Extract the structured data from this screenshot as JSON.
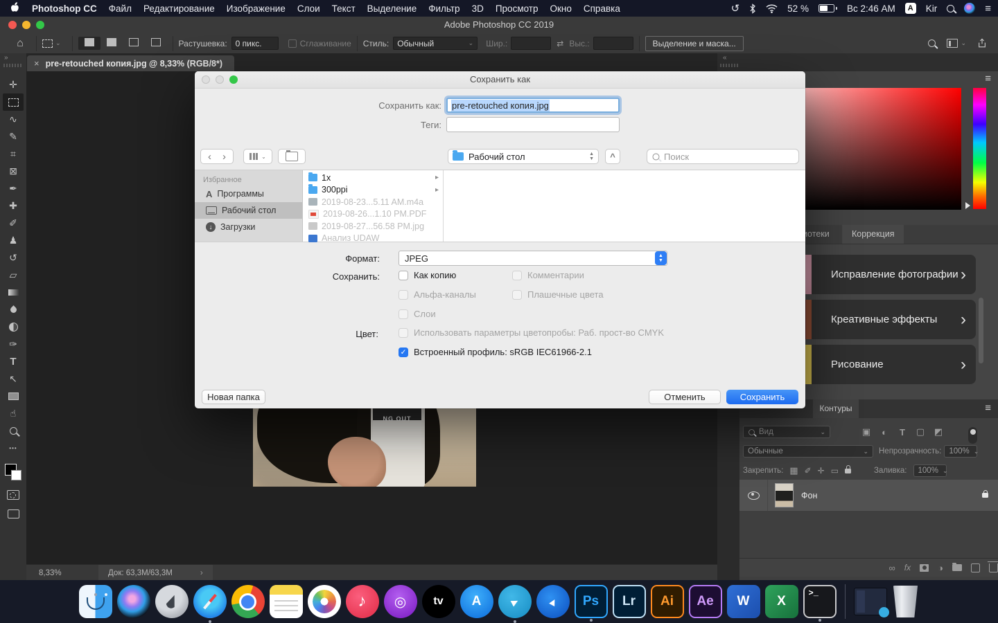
{
  "menubar": {
    "app_name": "Photoshop CC",
    "items": [
      "Файл",
      "Редактирование",
      "Изображение",
      "Слои",
      "Текст",
      "Выделение",
      "Фильтр",
      "3D",
      "Просмотр",
      "Окно",
      "Справка"
    ],
    "status": {
      "battery_pct": "52 %",
      "clock": "Вс 2:46 AM",
      "input_badge": "A",
      "layout": "Kir"
    }
  },
  "window": {
    "title": "Adobe Photoshop CC 2019"
  },
  "options": {
    "feather_label": "Растушевка:",
    "feather_value": "0 пикс.",
    "smoothing_label": "Сглаживание",
    "style_label": "Стиль:",
    "style_value": "Обычный",
    "width_label": "Шир.:",
    "height_label": "Выс.:",
    "select_mask_btn": "Выделение и маска..."
  },
  "doc_tab": {
    "title": "pre-retouched копия.jpg @ 8,33% (RGB/8*)"
  },
  "dialog": {
    "title": "Сохранить как",
    "saveas_label": "Сохранить как:",
    "filename": "pre-retouched копия.jpg",
    "tags_label": "Теги:",
    "location": "Рабочий стол",
    "search_placeholder": "Поиск",
    "favorites_header": "Избранное",
    "sidebar": [
      {
        "label": "Программы"
      },
      {
        "label": "Рабочий стол"
      },
      {
        "label": "Загрузки"
      }
    ],
    "files": [
      {
        "name": "1x"
      },
      {
        "name": "300ppi"
      },
      {
        "name": "2019-08-23...5.11 AM.m4a"
      },
      {
        "name": "2019-08-26...1.10 PM.PDF"
      },
      {
        "name": "2019-08-27...56.58 PM.jpg"
      },
      {
        "name": "Анализ UDAW"
      }
    ],
    "format_label": "Формат:",
    "format_value": "JPEG",
    "save_label": "Сохранить:",
    "opt_copy": "Как копию",
    "opt_comments": "Комментарии",
    "opt_alpha": "Альфа-каналы",
    "opt_spot": "Плашечные цвета",
    "opt_layers": "Слои",
    "color_label": "Цвет:",
    "proof_option": "Использовать параметры цветопробы:  Раб. прост-во CMYK",
    "profile_option": "Встроенный профиль:  sRGB IEC61966-2.1",
    "new_folder_btn": "Новая папка",
    "cancel_btn": "Отменить",
    "save_btn": "Сохранить"
  },
  "panels": {
    "libraries_tab": "Библиотеки",
    "adjust_tab": "Коррекция",
    "cards": [
      {
        "label": "Исправление фотографии"
      },
      {
        "label": "Креативные эффекты"
      },
      {
        "label": "Рисование"
      }
    ],
    "paths_tab": "Контуры",
    "layers": {
      "view_filter": "Вид",
      "blend_mode": "Обычные",
      "opacity_label": "Непрозрачность:",
      "opacity_value": "100%",
      "pin_label": "Закрепить:",
      "fill_label": "Заливка:",
      "fill_value": "100%",
      "layer_name": "Фон",
      "fx_label": "fx"
    }
  },
  "status_bar": {
    "zoom": "8,33%",
    "doc_info": "Док: 63,3M/63,3M"
  },
  "canvas": {
    "print_text": "NG OUT"
  },
  "dock": {
    "ps": "Ps",
    "lr": "Lr",
    "ai": "Ai",
    "ae": "Ae",
    "word": "W",
    "excel": "X",
    "tv_label": "tv",
    "appstore_label": "A",
    "terminal_prompt": ">_",
    "music_note": "♪",
    "podcast_glyph": "◎"
  },
  "icons": {
    "menu": "≡",
    "time_machine": "↺",
    "back": "‹",
    "forward": "›",
    "chev_down": "⌄",
    "chev_up": "^",
    "row_arrow": "▸",
    "breadcrumb": "›",
    "close": "×",
    "swap": "⇄",
    "home": "⌂",
    "collapse_l": "»",
    "collapse_r": "«",
    "move": "✛",
    "lasso": "∿",
    "quick_select": "✎",
    "crop": "⌗",
    "frame": "⊠",
    "eyedropper": "✒",
    "heal": "✚",
    "brush": "✐",
    "stamp": "♟",
    "history": "↺",
    "eraser": "▱",
    "pen": "✑",
    "type": "T",
    "path_select": "↖",
    "hand": "☝",
    "more": "•••",
    "download": "↓",
    "check": "✓",
    "bolt": "ϟ",
    "filter_image": "▣",
    "filter_adj": "◐",
    "filter_shape": "▢",
    "filter_smart": "◩",
    "checker": "▦",
    "lock_frame": "▭",
    "link": "∞",
    "half_circle": "◑",
    "stepper_up": "▲",
    "stepper_down": "▼"
  }
}
